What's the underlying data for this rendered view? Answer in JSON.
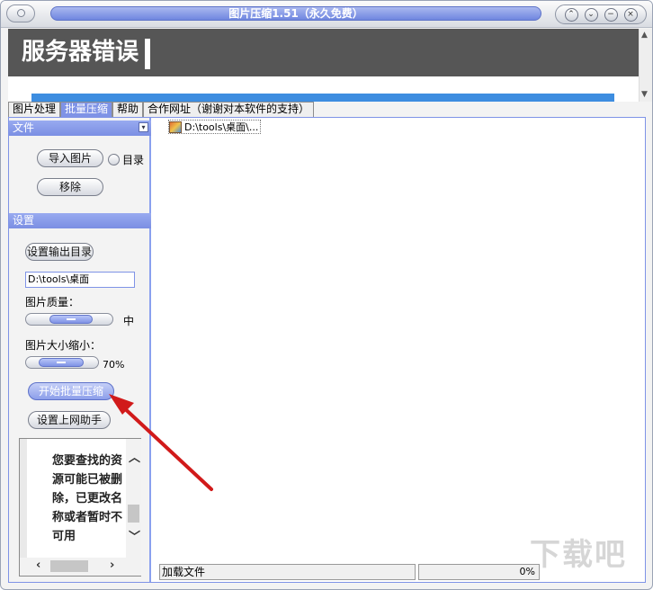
{
  "window": {
    "title": "图片压缩1.51（永久免费）",
    "controls": {
      "up": "⌃",
      "down": "⌄",
      "minimize": "−",
      "close": "×"
    }
  },
  "webarea": {
    "error_text": "服务器错误"
  },
  "tabs": [
    {
      "label": "图片处理",
      "active": false
    },
    {
      "label": "批量压缩",
      "active": true
    },
    {
      "label": "帮助",
      "active": false
    },
    {
      "label": "合作网址（谢谢对本软件的支持）",
      "active": false
    }
  ],
  "file_section": {
    "header": "文件",
    "toggle_icon": "chevron-down-icon",
    "import_label": "导入图片",
    "dir_radio_label": "目录",
    "remove_label": "移除"
  },
  "settings_section": {
    "header": "设置",
    "output_dir_button": "设置输出目录",
    "output_dir_value": "D:\\tools\\桌面",
    "quality_label": "图片质量：",
    "quality_value_label": "中",
    "size_label": "图片大小缩小：",
    "size_value_label": "70%",
    "start_button": "开始批量压缩",
    "assistant_button": "设置上网助手"
  },
  "ad_box": {
    "text": "您要查找的资源可能已被删除，已更改名称或者暂时不可用"
  },
  "file_list": [
    {
      "name": "D:\\tools\\桌面\\..."
    }
  ],
  "status_bar": {
    "left": "加载文件",
    "right": "0%"
  },
  "colors": {
    "accent": "#7f93e6",
    "error_banner": "#565656",
    "annotation_arrow": "#d11a1a"
  }
}
